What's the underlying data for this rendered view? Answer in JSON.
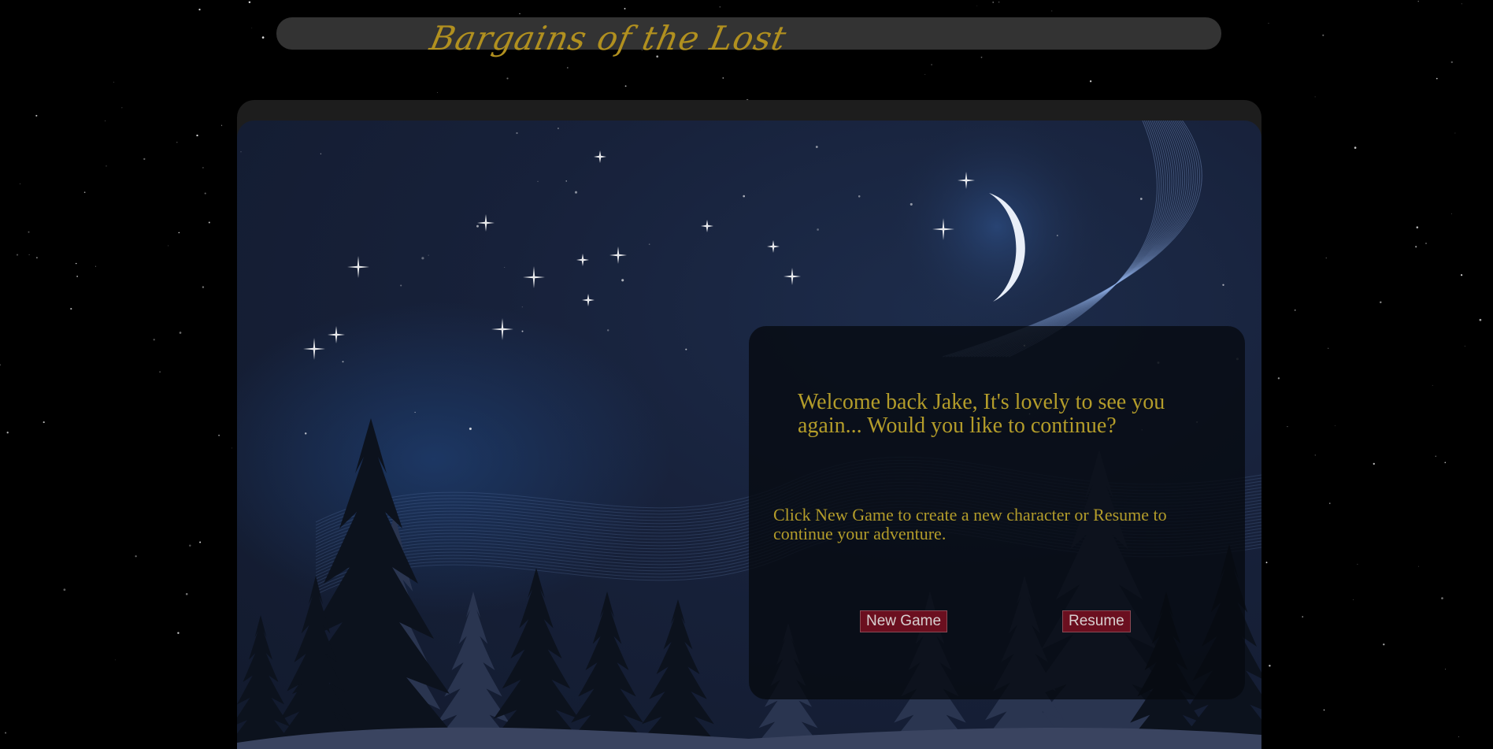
{
  "header": {
    "logo_text": "Bargains of the Lost",
    "logo_color": "#b1901f",
    "bar_color": "#333333"
  },
  "scene": {
    "background": "night-sky-with-crescent-moon-and-pine-trees"
  },
  "dialog": {
    "welcome": "Welcome back Jake, It's lovely to see you again... Would you like to continue?",
    "instructions": "Click New Game to create a new character or Resume to continue your adventure.",
    "text_color": "#b39c2a",
    "new_game_label": "New Game",
    "resume_label": "Resume",
    "button_color": "#6b0f1f"
  }
}
